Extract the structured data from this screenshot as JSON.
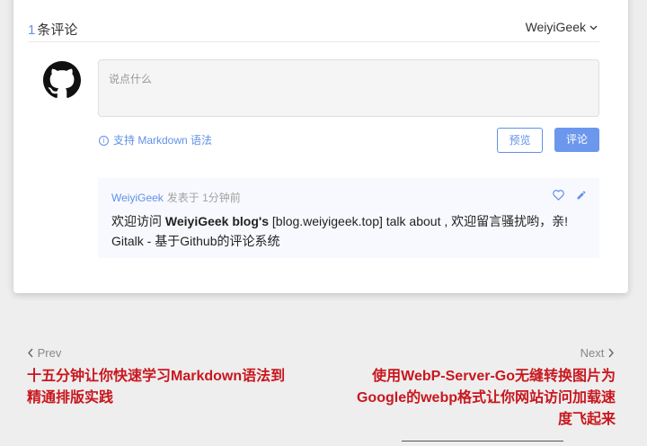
{
  "comments_header": {
    "count": "1",
    "count_label": "条评论",
    "user": "WeiyiGeek"
  },
  "editor": {
    "placeholder": "说点什么"
  },
  "markdown_tip": {
    "info_glyph": "i",
    "label": "支持 Markdown 语法"
  },
  "buttons": {
    "preview": "预览",
    "comment": "评论"
  },
  "comment": {
    "author": "WeiyiGeek",
    "posted": "发表于 1分钟前",
    "line1_pre": "欢迎访问 ",
    "line1_bold": "WeiyiGeek blog's",
    "line1_post": " [blog.weiyigeek.top] talk about , 欢迎留言骚扰哟，亲!",
    "line2": "Gitalk - 基于Github的评论系统"
  },
  "post_nav": {
    "prev_label": "Prev",
    "prev_title": "十五分钟让你快速学习Markdown语法到精通排版实践",
    "next_label": "Next",
    "next_title": "使用WebP-Server-Go无缝转换图片为Google的webp格式让你网站访问加载速度飞起来"
  },
  "colors": {
    "accent": "#6190e8",
    "link_red": "#c8171e",
    "page_bg": "#eeeeee"
  }
}
